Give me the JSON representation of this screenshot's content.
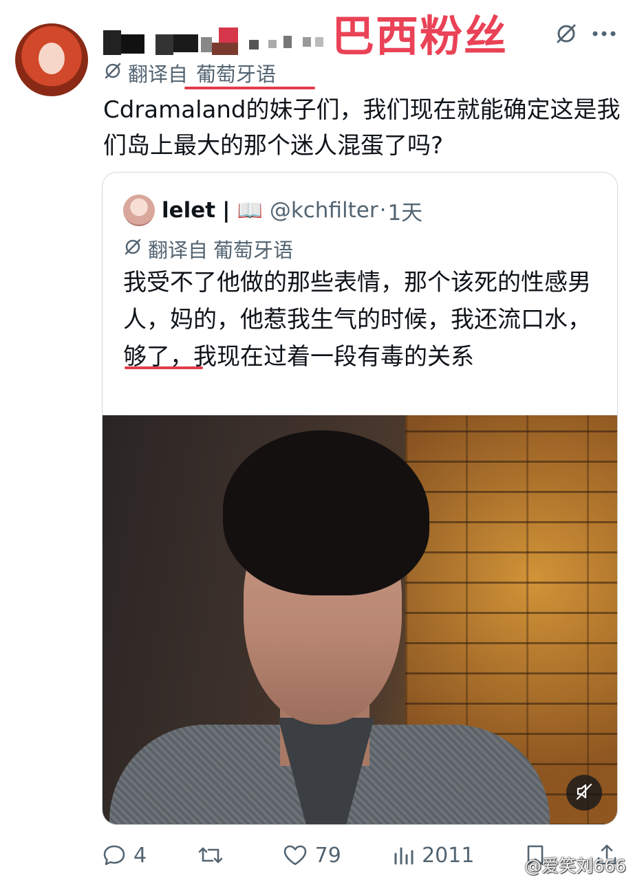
{
  "annotation": {
    "title": "巴西粉丝",
    "color": "#ea4256"
  },
  "tweet": {
    "translated_label": "翻译自",
    "language": "葡萄牙语",
    "text": "Cdramaland的妹子们，我们现在就能确定这是我们岛上最大的那个迷人混蛋了吗?"
  },
  "quote": {
    "name": "lelet",
    "separator": "|",
    "emoji": "📖",
    "handle": "@kchfilter",
    "dot": "·",
    "time": "1天",
    "translated_label": "翻译自",
    "language": "葡萄牙语",
    "text": "我受不了他做的那些表情，那个该死的性感男人，妈的，他惹我生气的时候，我还流口水，够了，我现在过着一段有毒的关系"
  },
  "actions": {
    "replies": "4",
    "reposts": "",
    "likes": "79",
    "views": "2011"
  },
  "watermark": {
    "text": "@爱笑刘666"
  },
  "colors": {
    "text": "#0f1419",
    "secondary": "#536471",
    "border": "#cfd9de",
    "underline": "#e23c4c"
  }
}
